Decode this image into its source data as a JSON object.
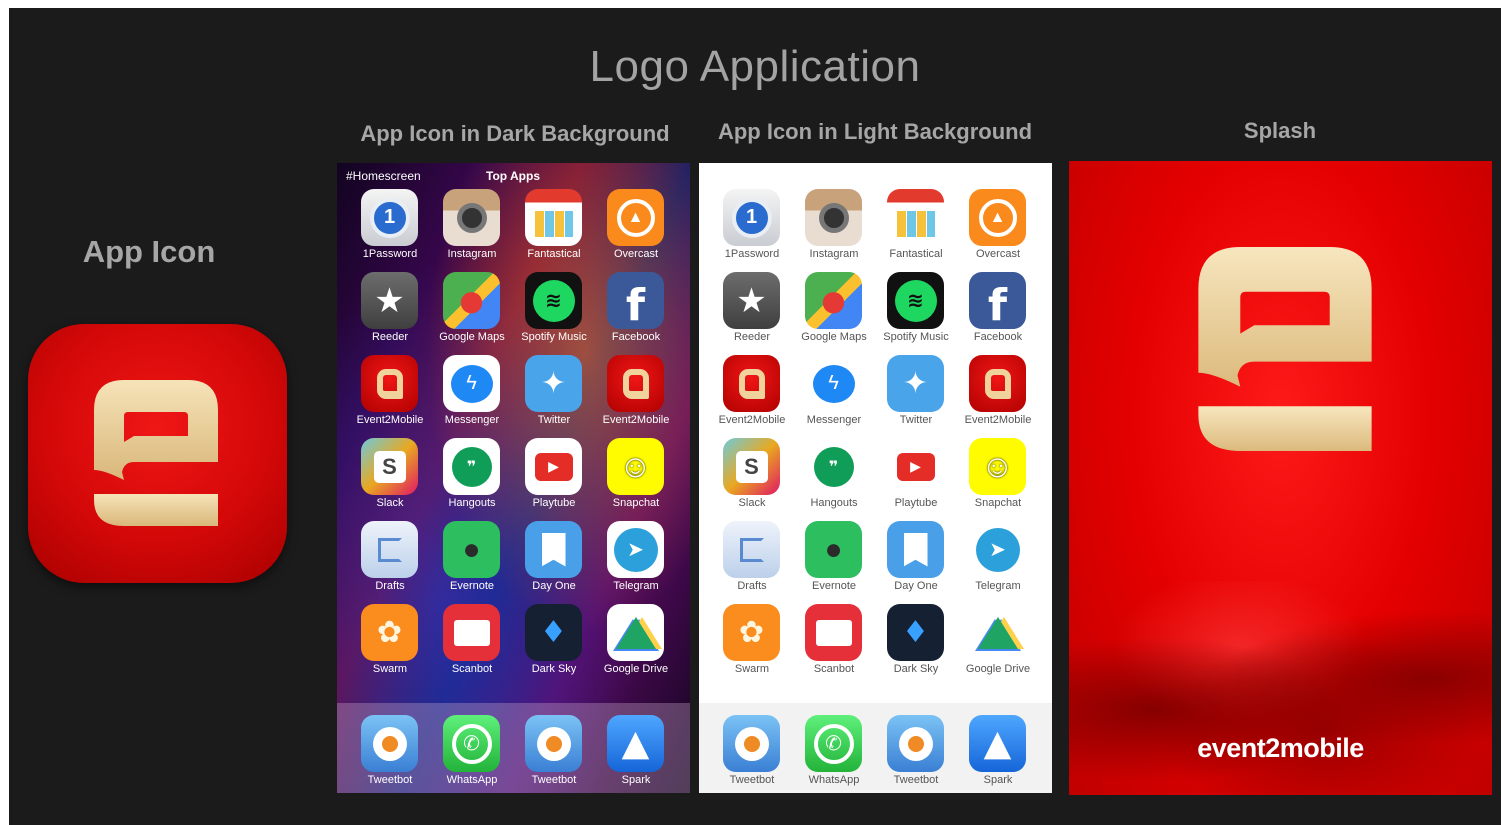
{
  "page": {
    "title": "Logo Application"
  },
  "sections": {
    "app_icon": "App Icon",
    "dark": "App Icon in Dark Background",
    "light": "App Icon in Light Background",
    "splash": "Splash"
  },
  "homescreen": {
    "hashtag": "#Homescreen",
    "top_apps": "Top Apps"
  },
  "apps": [
    {
      "label": "1Password",
      "icon": "1password-icon"
    },
    {
      "label": "Instagram",
      "icon": "instagram-icon"
    },
    {
      "label": "Fantastical",
      "icon": "fantastical-icon"
    },
    {
      "label": "Overcast",
      "icon": "overcast-icon"
    },
    {
      "label": "Reeder",
      "icon": "reeder-icon"
    },
    {
      "label": "Google Maps",
      "icon": "google-maps-icon"
    },
    {
      "label": "Spotify Music",
      "icon": "spotify-icon"
    },
    {
      "label": "Facebook",
      "icon": "facebook-icon"
    },
    {
      "label": "Event2Mobile",
      "icon": "event2mobile-icon"
    },
    {
      "label": "Messenger",
      "icon": "messenger-icon"
    },
    {
      "label": "Twitter",
      "icon": "twitter-icon"
    },
    {
      "label": "Event2Mobile",
      "icon": "event2mobile-icon"
    },
    {
      "label": "Slack",
      "icon": "slack-icon"
    },
    {
      "label": "Hangouts",
      "icon": "hangouts-icon"
    },
    {
      "label": "Playtube",
      "icon": "playtube-icon"
    },
    {
      "label": "Snapchat",
      "icon": "snapchat-icon"
    },
    {
      "label": "Drafts",
      "icon": "drafts-icon"
    },
    {
      "label": "Evernote",
      "icon": "evernote-icon"
    },
    {
      "label": "Day One",
      "icon": "day-one-icon"
    },
    {
      "label": "Telegram",
      "icon": "telegram-icon"
    },
    {
      "label": "Swarm",
      "icon": "swarm-icon"
    },
    {
      "label": "Scanbot",
      "icon": "scanbot-icon"
    },
    {
      "label": "Dark Sky",
      "icon": "dark-sky-icon"
    },
    {
      "label": "Google Drive",
      "icon": "google-drive-icon"
    }
  ],
  "dock": [
    {
      "label": "Tweetbot",
      "icon": "tweetbot-icon"
    },
    {
      "label": "WhatsApp",
      "icon": "whatsapp-icon"
    },
    {
      "label": "Tweetbot",
      "icon": "tweetbot-icon"
    },
    {
      "label": "Spark",
      "icon": "spark-icon"
    }
  ],
  "splash": {
    "wordmark": "event2mobile"
  },
  "colors": {
    "board": "#1b1b1b",
    "brand_red": "#e40000",
    "logo_gold": "#e8cf98"
  }
}
